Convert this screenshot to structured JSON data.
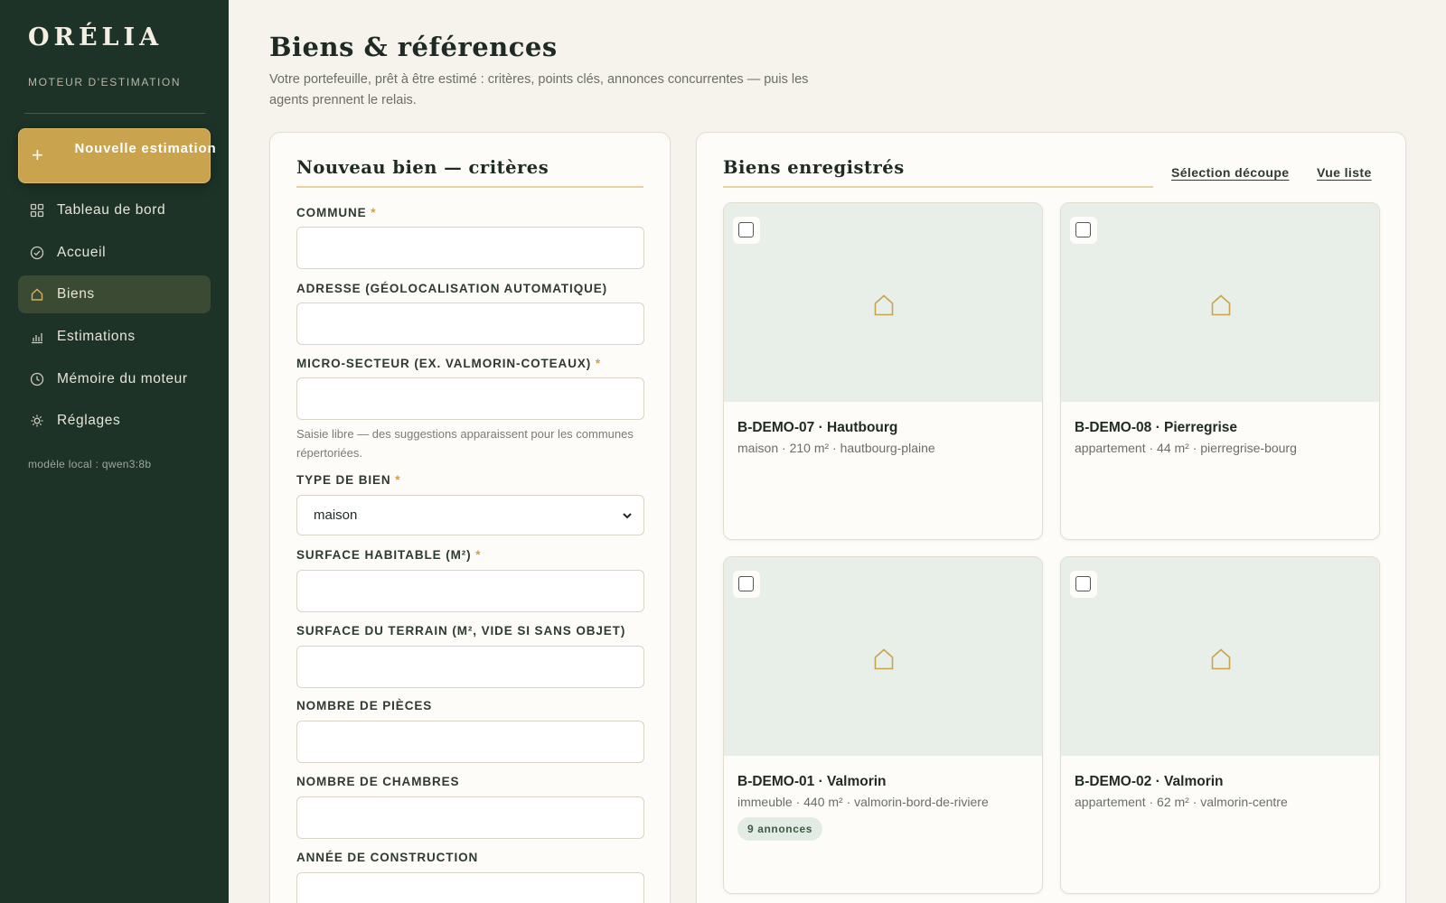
{
  "brand": {
    "name": "ORÉLIA",
    "tagline": "MOTEUR D'ESTIMATION"
  },
  "sidebar": {
    "new_button": {
      "icon": "plus-icon",
      "label": "Nouvelle estimation"
    },
    "items": [
      {
        "label": "Tableau de bord",
        "icon": "grid-icon",
        "active": false
      },
      {
        "label": "Accueil",
        "icon": "check-circle-icon",
        "active": false
      },
      {
        "label": "Biens",
        "icon": "house-icon",
        "active": true
      },
      {
        "label": "Estimations",
        "icon": "bar-chart-icon",
        "active": false
      },
      {
        "label": "Mémoire du moteur",
        "icon": "clock-icon",
        "active": false
      },
      {
        "label": "Réglages",
        "icon": "sun-icon",
        "active": false
      }
    ],
    "model_note": "modèle local : qwen3:8b"
  },
  "header": {
    "title": "Biens & références",
    "description": "Votre portefeuille, prêt à être estimé : critères, points clés, annonces concurrentes — puis les agents prennent le relais."
  },
  "form": {
    "title": "Nouveau bien — critères",
    "fields": {
      "commune": {
        "label": "COMMUNE",
        "required": true,
        "value": ""
      },
      "adresse": {
        "label": "ADRESSE (GÉOLOCALISATION AUTOMATIQUE)",
        "required": false,
        "value": ""
      },
      "micro_secteur": {
        "label": "MICRO-SECTEUR (EX. VALMORIN-COTEAUX)",
        "required": true,
        "value": "",
        "hint": "Saisie libre — des suggestions apparaissent pour les communes répertoriées."
      },
      "type_de_bien": {
        "label": "TYPE DE BIEN",
        "required": true,
        "value": "maison"
      },
      "surface_habitable": {
        "label": "SURFACE HABITABLE (M²)",
        "required": true,
        "value": ""
      },
      "surface_terrain": {
        "label": "SURFACE DU TERRAIN (M², VIDE SI SANS OBJET)",
        "required": false,
        "value": ""
      },
      "nombre_pieces": {
        "label": "NOMBRE DE PIÈCES",
        "required": false,
        "value": ""
      },
      "nombre_chambres": {
        "label": "NOMBRE DE CHAMBRES",
        "required": false,
        "value": ""
      },
      "annee_construction": {
        "label": "ANNÉE DE CONSTRUCTION",
        "required": false,
        "value": ""
      }
    },
    "required_mark": "*"
  },
  "saved": {
    "title": "Biens enregistrés",
    "links": {
      "selection": "Sélection découpe",
      "list_view": "Vue liste"
    },
    "cards": [
      {
        "title": "B-DEMO-07 · Hautbourg",
        "subtitle": "maison · 210 m² · hautbourg-plaine",
        "badge": "",
        "checked": false
      },
      {
        "title": "B-DEMO-08 · Pierregrise",
        "subtitle": "appartement · 44 m² · pierregrise-bourg",
        "badge": "",
        "checked": false
      },
      {
        "title": "B-DEMO-01 · Valmorin",
        "subtitle": "immeuble · 440 m² · valmorin-bord-de-riviere",
        "badge": "9 annonces",
        "checked": false
      },
      {
        "title": "B-DEMO-02 · Valmorin",
        "subtitle": "appartement · 62 m² · valmorin-centre",
        "badge": "",
        "checked": false
      }
    ]
  },
  "colors": {
    "sidebar_bg": "#1d3327",
    "accent_gold": "#c9a34e",
    "page_bg": "#f6f3ed",
    "thumb_bg": "#e8eee8"
  }
}
